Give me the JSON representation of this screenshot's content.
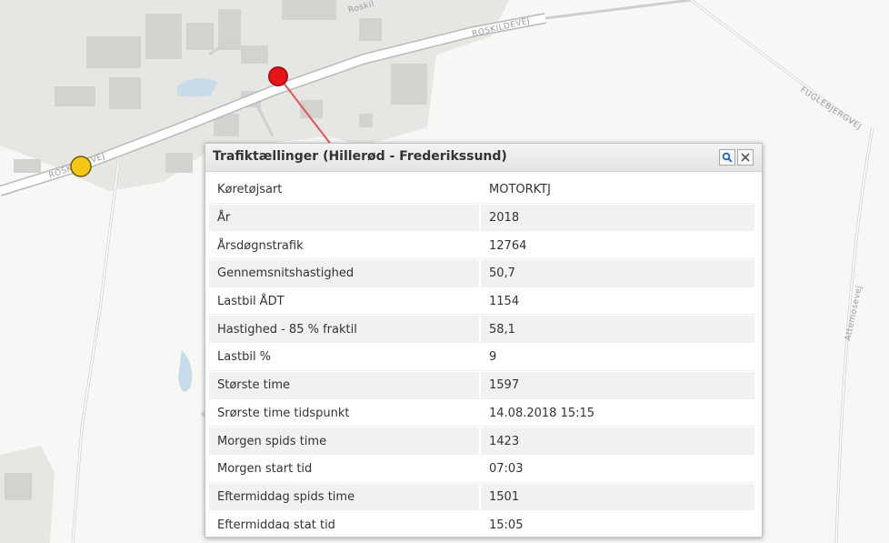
{
  "map": {
    "road_labels": [
      "ROSKILDEVEJ",
      "Roskil",
      "FUGLEBJERGVEJ",
      "Attemosevej",
      "ROSKILDEVEJ"
    ],
    "markers": [
      {
        "name": "traffic-count-point-selected",
        "color": "#e8141c"
      },
      {
        "name": "traffic-count-point",
        "color": "#f5c518"
      }
    ]
  },
  "popup": {
    "title": "Trafiktællinger (Hillerød - Frederikssund)",
    "rows": [
      {
        "key": "Køretøjsart",
        "value": "MOTORKTJ"
      },
      {
        "key": "År",
        "value": "2018"
      },
      {
        "key": "Årsdøgnstrafik",
        "value": "12764"
      },
      {
        "key": "Gennemsnitshastighed",
        "value": "50,7"
      },
      {
        "key": "Lastbil ÅDT",
        "value": "1154"
      },
      {
        "key": "Hastighed - 85 % fraktil",
        "value": "58,1"
      },
      {
        "key": "Lastbil %",
        "value": "9"
      },
      {
        "key": "Største time",
        "value": "1597"
      },
      {
        "key": "Srørste time tidspunkt",
        "value": "14.08.2018 15:15"
      },
      {
        "key": "Morgen spids time",
        "value": "1423"
      },
      {
        "key": "Morgen start tid",
        "value": "07:03"
      },
      {
        "key": "Eftermiddag spids time",
        "value": "1501"
      },
      {
        "key": "Eftermiddag stat tid",
        "value": "15:05"
      }
    ],
    "buttons": {
      "zoom_icon": "magnifier-icon",
      "close_icon": "close-icon"
    }
  },
  "colors": {
    "selected_marker": "#e8141c",
    "marker": "#f5c518",
    "leader_line": "#e05555"
  }
}
